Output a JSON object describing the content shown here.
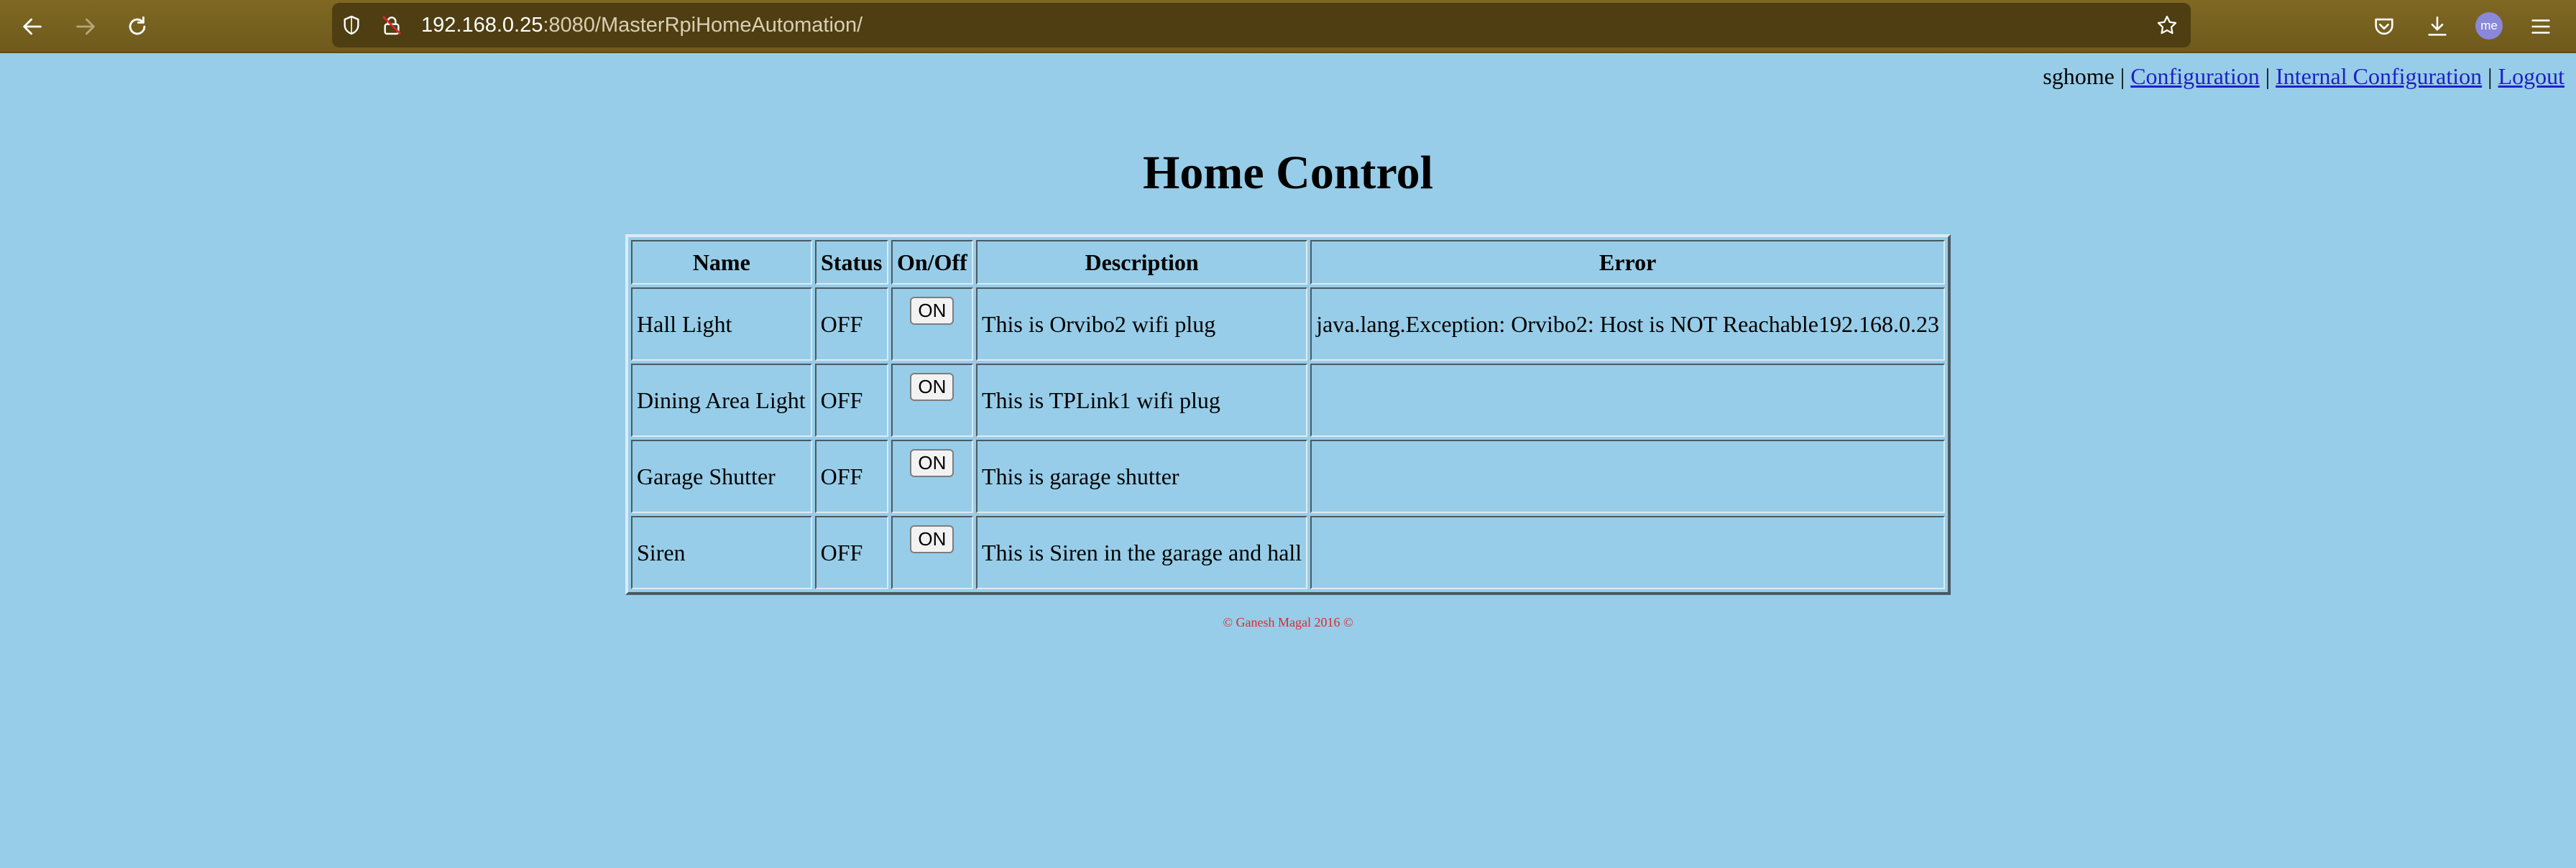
{
  "browser": {
    "url_host": "192.168.0.25",
    "url_rest": ":8080/MasterRpiHomeAutomation/",
    "avatar_text": "me",
    "chrome_color": "#7a6421",
    "icons": [
      "back-arrow-icon",
      "forward-arrow-icon",
      "reload-icon",
      "shield-icon",
      "insecure-lock-icon",
      "star-icon",
      "pocket-icon",
      "download-icon",
      "menu-icon"
    ]
  },
  "header": {
    "user": "sghome",
    "separator": " | ",
    "links": [
      "Configuration",
      "Internal Configuration",
      "Logout"
    ]
  },
  "title": "Home Control",
  "table": {
    "columns": [
      "Name",
      "Status",
      "On/Off",
      "Description",
      "Error"
    ],
    "rows": [
      {
        "name": "Hall Light",
        "status": "OFF",
        "button": "ON",
        "description": "This is Orvibo2 wifi plug",
        "error": "java.lang.Exception: Orvibo2: Host is NOT Reachable192.168.0.23"
      },
      {
        "name": "Dining Area Light",
        "status": "OFF",
        "button": "ON",
        "description": "This is TPLink1 wifi plug",
        "error": ""
      },
      {
        "name": "Garage Shutter",
        "status": "OFF",
        "button": "ON",
        "description": "This is garage shutter",
        "error": ""
      },
      {
        "name": "Siren",
        "status": "OFF",
        "button": "ON",
        "description": "This is Siren in the garage and hall",
        "error": ""
      }
    ]
  },
  "footer": "© Ganesh Magal 2016 ©",
  "colors": {
    "page_background": "#97cde8",
    "link": "#2020c8",
    "footer_text": "#e0272a"
  }
}
